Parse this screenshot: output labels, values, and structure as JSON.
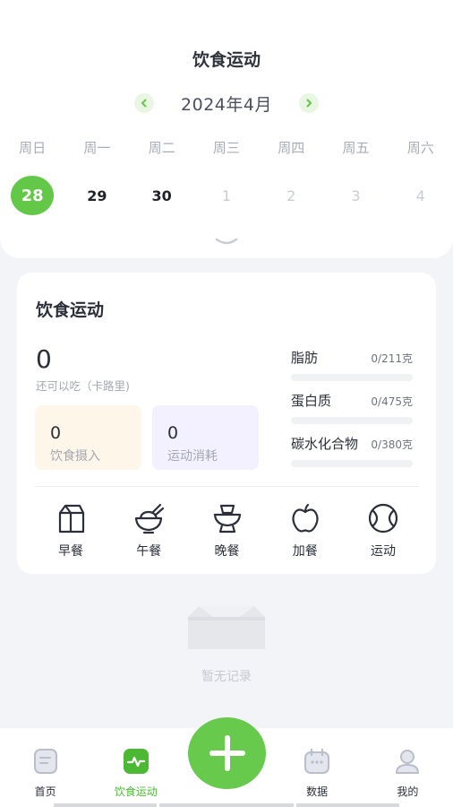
{
  "header": {
    "title": "饮食运动",
    "month": "2024年4月",
    "weekdays": [
      "周日",
      "周一",
      "周二",
      "周三",
      "周四",
      "周五",
      "周六"
    ],
    "dates": [
      "28",
      "29",
      "30",
      "1",
      "2",
      "3",
      "4"
    ],
    "selected_date": "28"
  },
  "summary": {
    "title": "饮食运动",
    "remaining_value": "0",
    "remaining_label": "还可以吃（卡路里)",
    "intake_value": "0",
    "intake_label": "饮食摄入",
    "burn_value": "0",
    "burn_label": "运动消耗",
    "nutrients": [
      {
        "name": "脂肪",
        "amount": "0/211克",
        "progress": 0
      },
      {
        "name": "蛋白质",
        "amount": "0/475克",
        "progress": 0
      },
      {
        "name": "碳水化合物",
        "amount": "0/380克",
        "progress": 0
      }
    ],
    "meals": [
      "早餐",
      "午餐",
      "晚餐",
      "加餐",
      "运动"
    ]
  },
  "empty": {
    "text": "暂无记录"
  },
  "tabbar": {
    "items": [
      "首页",
      "饮食运动",
      "",
      "数据",
      "我的"
    ],
    "active": "饮食运动"
  },
  "colors": {
    "accent": "#63c848",
    "intake_bg": "#fff6ea",
    "burn_bg": "#f3f1ff"
  }
}
